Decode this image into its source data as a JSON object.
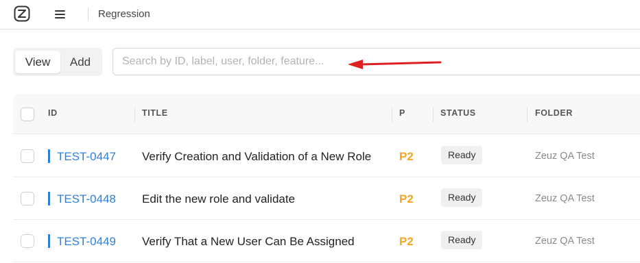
{
  "header": {
    "breadcrumb": "Regression",
    "logo_icon": "logo-icon",
    "menu_icon": "hamburger-menu-icon"
  },
  "toggle": {
    "view_label": "View",
    "add_label": "Add"
  },
  "search": {
    "placeholder": "Search by ID, label, user, folder, feature...",
    "value": ""
  },
  "annotation": {
    "arrow_color": "#e02020"
  },
  "table": {
    "columns": [
      "ID",
      "TITLE",
      "P",
      "STATUS",
      "FOLDER"
    ],
    "rows": [
      {
        "id": "TEST-0447",
        "title": "Verify Creation and Validation of a New Role",
        "priority": "P2",
        "status": "Ready",
        "folder": "Zeuz QA Test"
      },
      {
        "id": "TEST-0448",
        "title": "Edit the new role and validate",
        "priority": "P2",
        "status": "Ready",
        "folder": "Zeuz QA Test"
      },
      {
        "id": "TEST-0449",
        "title": "Verify That a New User Can Be Assigned",
        "priority": "P2",
        "status": "Ready",
        "folder": "Zeuz QA Test"
      }
    ]
  },
  "colors": {
    "id_link": "#2f80d9",
    "priority": "#f5a623",
    "status_badge_bg": "#f0f0f0"
  }
}
